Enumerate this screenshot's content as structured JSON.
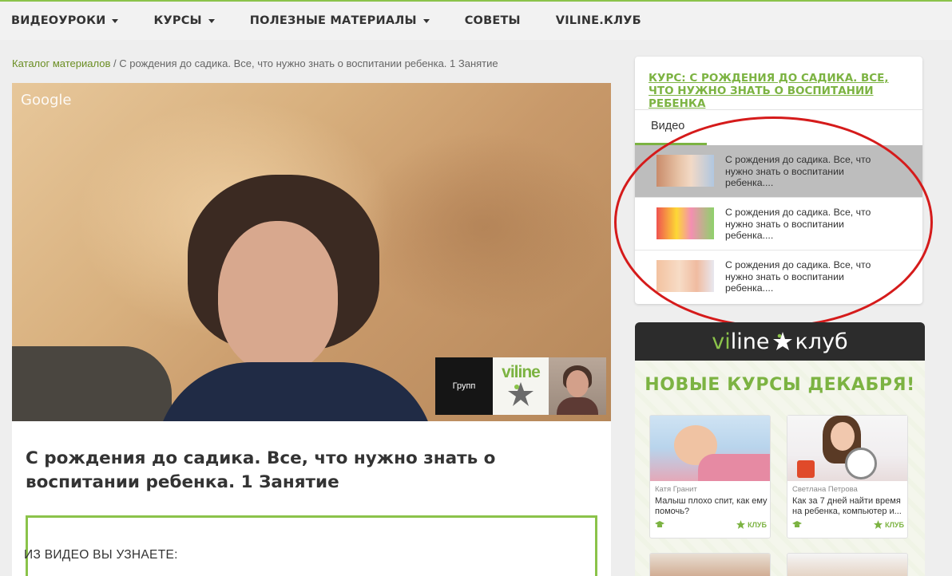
{
  "nav": {
    "items": [
      {
        "label": "ВИДЕОУРОКИ",
        "dropdown": true
      },
      {
        "label": "КУРСЫ",
        "dropdown": true
      },
      {
        "label": "ПОЛЕЗНЫЕ МАТЕРИАЛЫ",
        "dropdown": true
      },
      {
        "label": "СОВЕТЫ",
        "dropdown": false
      },
      {
        "label": "VILINE.КЛУБ",
        "dropdown": false
      }
    ]
  },
  "breadcrumb": {
    "link": "Каталог материалов",
    "separator": " / ",
    "current": "С рождения до садика. Все, что нужно знать о воспитании ребенка. 1 Занятие"
  },
  "video": {
    "watermark": "Google",
    "pip_group_label": "Групп",
    "pip_logo_text": "viline"
  },
  "article": {
    "title": "С рождения до садика. Все, что нужно знать о воспитании ребенка. 1 Занятие",
    "learn_heading": "ИЗ ВИДЕО ВЫ УЗНАЕТЕ:"
  },
  "course": {
    "title": "КУРС: С РОЖДЕНИЯ ДО САДИКА. ВСЕ, ЧТО НУЖНО ЗНАТЬ О ВОСПИТАНИИ РЕБЕНКА",
    "tab": "Видео",
    "items": [
      {
        "text": "С рождения до садика. Все, что нужно знать о воспитании ребенка....",
        "active": true
      },
      {
        "text": "С рождения до садика. Все, что нужно знать о воспитании ребенка....",
        "active": false
      },
      {
        "text": "С рождения до садика. Все, что нужно знать о воспитании ребенка....",
        "active": false
      }
    ]
  },
  "club": {
    "logo_vi": "vi",
    "logo_line": "line",
    "logo_club": "клуб",
    "headline": "НОВЫЕ КУРСЫ ДЕКАБРЯ!",
    "cards": [
      {
        "author": "Катя Гранит",
        "title": "Малыш плохо спит, как ему помочь?",
        "tag": "КЛУБ"
      },
      {
        "author": "Светлана Петрова",
        "title": "Как за 7 дней найти время на ребенка, компьютер и...",
        "tag": "КЛУБ"
      }
    ]
  },
  "colors": {
    "accent_green": "#7cb342",
    "annotation_red": "#d51b1b",
    "active_row": "#bdbdbd"
  }
}
